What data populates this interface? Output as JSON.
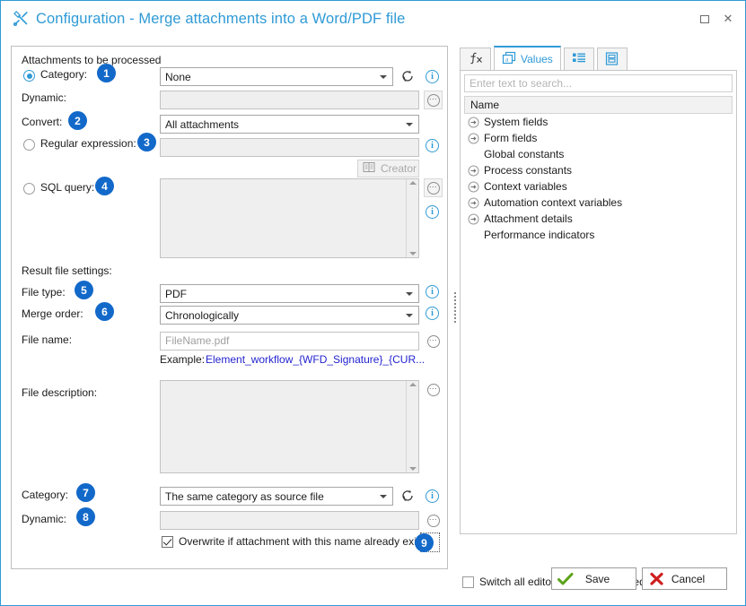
{
  "window": {
    "title": "Configuration - Merge attachments into a Word/PDF file",
    "title_icon": "tools-icon",
    "maximize_icon": "maximize-icon",
    "close_label": "✕"
  },
  "left": {
    "group_label": "Attachments to be processed",
    "category": {
      "label": "Category:",
      "badge": "1",
      "value": "None",
      "selected": true,
      "refresh_icon": "refresh-icon",
      "info_icon": "info-icon"
    },
    "dynamic": {
      "label": "Dynamic:",
      "value": "",
      "ellipsis_label": "⋯"
    },
    "convert": {
      "label": "Convert:",
      "badge": "2",
      "value": "All attachments"
    },
    "regex": {
      "label": "Regular expression:",
      "badge": "3",
      "value": "",
      "selected": false,
      "info_icon": "info-icon"
    },
    "creator": {
      "label": "Creator",
      "icon": "book-icon",
      "disabled": true
    },
    "sql": {
      "label": "SQL query:",
      "badge": "4",
      "value": "",
      "selected": false,
      "info_icon": "info-icon"
    },
    "result_settings_label": "Result file settings:",
    "file_type": {
      "label": "File type:",
      "badge": "5",
      "value": "PDF",
      "info_icon": "info-icon"
    },
    "merge_order": {
      "label": "Merge order:",
      "badge": "6",
      "value": "Chronologically",
      "info_icon": "info-icon"
    },
    "file_name": {
      "label": "File name:",
      "placeholder": "FileName.pdf",
      "value": ""
    },
    "example": {
      "label": "Example:",
      "link": "Element_workflow_{WFD_Signature}_{CUR..."
    },
    "file_description": {
      "label": "File description:",
      "value": ""
    },
    "result_category": {
      "label": "Category:",
      "badge": "7",
      "value": "The same category as source file",
      "refresh_icon": "refresh-icon",
      "info_icon": "info-icon"
    },
    "result_dynamic": {
      "label": "Dynamic:",
      "badge": "8",
      "value": ""
    },
    "overwrite": {
      "label": "Overwrite if attachment with this name already exists",
      "checked": true,
      "badge": "9"
    }
  },
  "right": {
    "tabs": [
      {
        "label": "",
        "icon": "function-fx-icon",
        "active": false
      },
      {
        "label": "Values",
        "icon": "values-cards-icon",
        "active": true
      },
      {
        "label": "",
        "icon": "list-detail-icon",
        "active": false
      },
      {
        "label": "",
        "icon": "document-panel-icon",
        "active": false
      }
    ],
    "search_placeholder": "Enter text to search...",
    "search_value": "",
    "column_header": "Name",
    "tree_items": [
      {
        "label": "System fields",
        "expandable": true
      },
      {
        "label": "Form fields",
        "expandable": true
      },
      {
        "label": "Global constants",
        "expandable": false
      },
      {
        "label": "Process constants",
        "expandable": true
      },
      {
        "label": "Context variables",
        "expandable": true
      },
      {
        "label": "Automation context variables",
        "expandable": true
      },
      {
        "label": "Attachment details",
        "expandable": true
      },
      {
        "label": "Performance indicators",
        "expandable": false
      }
    ]
  },
  "bottom": {
    "advanced_mode": {
      "label": "Switch all editors into advanced edit mode",
      "checked": false
    },
    "save": {
      "label": "Save",
      "icon": "green-check-icon"
    },
    "cancel": {
      "label": "Cancel",
      "icon": "red-x-icon"
    }
  },
  "colors": {
    "accent": "#2f9ad6",
    "badge": "#1269c9",
    "link": "#2323d0",
    "save_icon": "#5aa318",
    "cancel_icon": "#cf2020"
  }
}
